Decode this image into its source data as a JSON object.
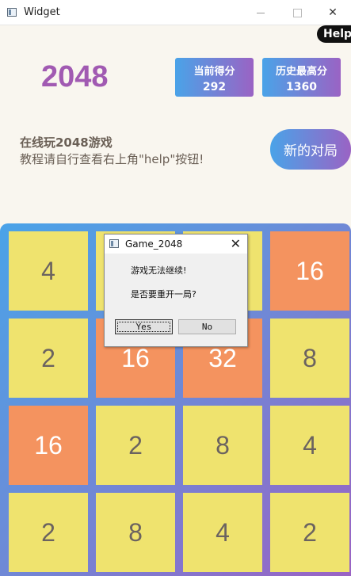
{
  "window": {
    "title": "Widget",
    "close_glyph": "✕"
  },
  "header": {
    "help_label": "Help",
    "logo": "2048",
    "current_score": {
      "label": "当前得分",
      "value": "292"
    },
    "best_score": {
      "label": "历史最高分",
      "value": "1360"
    },
    "intro_line1": "在线玩2048游戏",
    "intro_line2": "教程请自行查看右上角\"help\"按钮!",
    "new_game_label": "新的对局"
  },
  "board": {
    "tiles": [
      [
        "4",
        "",
        "",
        "16"
      ],
      [
        "2",
        "16",
        "32",
        "8"
      ],
      [
        "16",
        "2",
        "8",
        "4"
      ],
      [
        "2",
        "8",
        "4",
        "2"
      ]
    ]
  },
  "tile_colors": {
    "2": {
      "bg": "#efe36e",
      "fg": "#6b6360"
    },
    "4": {
      "bg": "#efe36e",
      "fg": "#6b6360"
    },
    "8": {
      "bg": "#efe36e",
      "fg": "#6b6360"
    },
    "16": {
      "bg": "#f4935f",
      "fg": "#ffffff"
    },
    "32": {
      "bg": "#f4935f",
      "fg": "#ffffff"
    },
    "": {
      "bg": "#efe36e",
      "fg": "#6b6360"
    }
  },
  "dialog": {
    "title": "Game_2048",
    "close_glyph": "✕",
    "message1": "游戏无法继续!",
    "message2": "是否要重开一局?",
    "yes_label": "Yes",
    "no_label": "No"
  }
}
